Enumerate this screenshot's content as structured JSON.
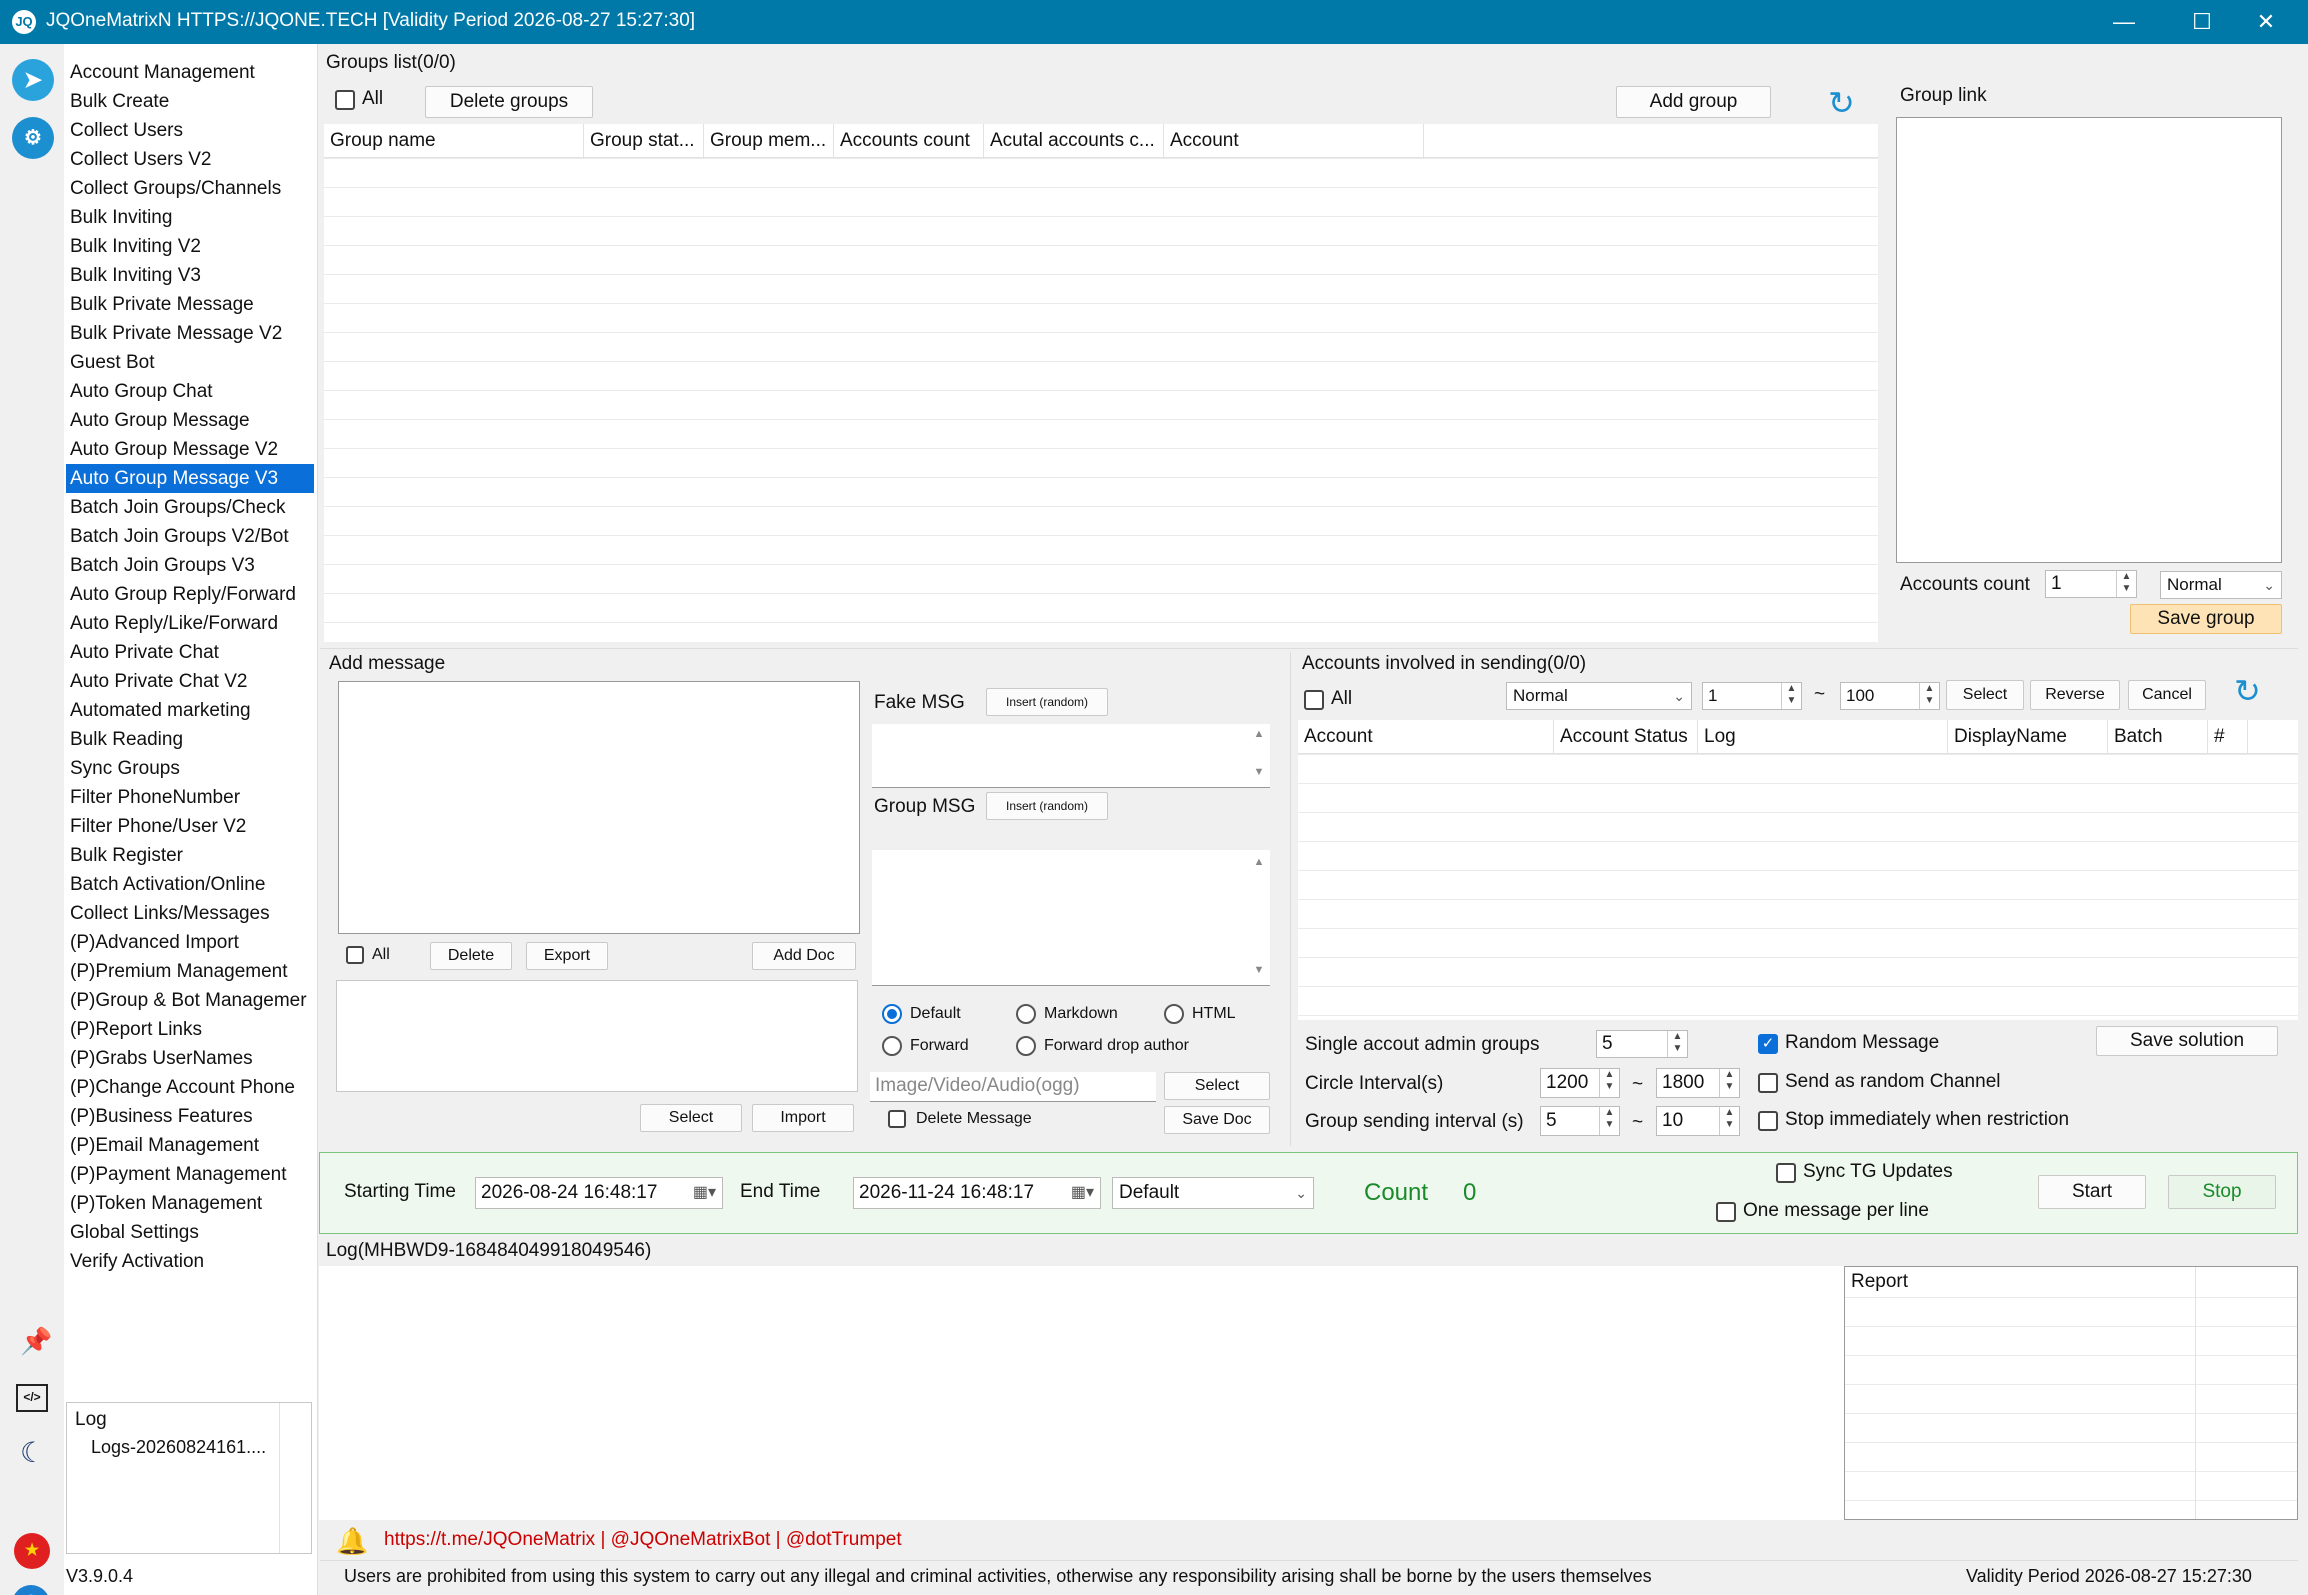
{
  "window": {
    "title": "JQOneMatrixN HTTPS://JQONE.TECH  [Validity Period 2026-08-27 15:27:30]",
    "app_icon_text": "JQ",
    "minimize": "—",
    "maximize": "☐",
    "close": "✕"
  },
  "sidebar_icons": [
    "telegram-icon",
    "tools-icon",
    "pin-icon",
    "code-icon",
    "moon-icon",
    "china-flag-icon",
    "help-icon"
  ],
  "menu": {
    "items": [
      "Account Management",
      "Bulk Create",
      "Collect Users",
      "Collect Users V2",
      "Collect Groups/Channels",
      "Bulk Inviting",
      "Bulk Inviting V2",
      "Bulk Inviting V3",
      "Bulk Private Message",
      "Bulk Private Message V2",
      "Guest Bot",
      "Auto Group Chat",
      "Auto Group Message",
      "Auto Group Message V2",
      "Auto Group Message V3",
      "Batch Join Groups/Check",
      "Batch Join Groups V2/Bot",
      "Batch Join Groups V3",
      "Auto Group Reply/Forward",
      "Auto Reply/Like/Forward",
      "Auto Private Chat",
      "Auto Private Chat V2",
      "Automated marketing",
      "Bulk Reading",
      "Sync Groups",
      "Filter PhoneNumber",
      "Filter Phone/User V2",
      "Bulk Register",
      "Batch Activation/Online",
      "Collect Links/Messages",
      "(P)Advanced Import",
      "(P)Premium Management",
      "(P)Group & Bot Managemer",
      "(P)Report Links",
      "(P)Grabs UserNames",
      "(P)Change Account Phone",
      "(P)Business Features",
      "(P)Email Management",
      "(P)Payment Management",
      "(P)Token Management",
      "Global Settings",
      "Verify Activation"
    ],
    "active_index": 14
  },
  "log_list": {
    "header": "Log",
    "item": "Logs-20260824161...."
  },
  "version": "V3.9.0.4",
  "groups": {
    "title": "Groups list(0/0)",
    "all_label": "All",
    "delete_button": "Delete groups",
    "add_button": "Add group",
    "columns": [
      "Group name",
      "Group stat...",
      "Group mem...",
      "Accounts count",
      "Acutal accounts c...",
      "Account"
    ]
  },
  "group_link": {
    "title": "Group link",
    "accounts_count_label": "Accounts count",
    "accounts_count_value": "1",
    "mode_value": "Normal",
    "save_button": "Save group"
  },
  "add_message": {
    "title": "Add message",
    "all_label": "All",
    "delete_button": "Delete",
    "export_button": "Export",
    "add_doc_button": "Add Doc",
    "select_button": "Select",
    "import_button": "Import"
  },
  "fake_msg": {
    "label": "Fake MSG",
    "insert_button": "Insert (random)"
  },
  "group_msg": {
    "label": "Group MSG",
    "insert_button": "Insert (random)"
  },
  "format": {
    "default": "Default",
    "markdown": "Markdown",
    "html": "HTML",
    "forward": "Forward",
    "forward_drop": "Forward drop author",
    "selected": "Default"
  },
  "media": {
    "placeholder": "Image/Video/Audio(ogg)",
    "select_button": "Select",
    "delete_message": "Delete Message",
    "save_doc_button": "Save Doc"
  },
  "accounts": {
    "title": "Accounts involved in sending(0/0)",
    "all_label": "All",
    "mode_value": "Normal",
    "from_value": "1",
    "tilde": "~",
    "to_value": "100",
    "select_button": "Select",
    "reverse_button": "Reverse",
    "cancel_button": "Cancel",
    "columns": [
      "Account",
      "Account Status",
      "Log",
      "DisplayName",
      "Batch",
      "#"
    ]
  },
  "settings": {
    "admin_groups_label": "Single accout admin groups",
    "admin_groups_value": "5",
    "circle_label": "Circle Interval(s)",
    "circle_min": "1200",
    "circle_max": "1800",
    "group_interval_label": "Group sending interval (s)",
    "group_min": "5",
    "group_max": "10",
    "tilde": "~",
    "random_message": "Random Message",
    "random_channel": "Send as random Channel",
    "stop_restriction": "Stop immediately when restriction",
    "save_solution_button": "Save solution"
  },
  "schedule": {
    "start_label": "Starting Time",
    "start_value": "2026-08-24 16:48:17",
    "end_label": "End Time",
    "end_value": "2026-11-24 16:48:17",
    "mode_value": "Default",
    "count_label": "Count",
    "count_value": "0",
    "sync_tg": "Sync TG Updates",
    "one_per_line": "One message per line",
    "start_button": "Start",
    "stop_button": "Stop"
  },
  "log": {
    "title": "Log(MHBWD9-168484049918049546)",
    "report_header": "Report"
  },
  "footer": {
    "links": "https://t.me/JQOneMatrix | @JQOneMatrixBot | @dotTrumpet",
    "notice": "Users are prohibited from using this system to carry out any illegal and criminal activities, otherwise any responsibility arising shall be borne by the users themselves",
    "validity": "Validity Period 2026-08-27 15:27:30"
  },
  "colors": {
    "titlebar": "#0078a8",
    "accent": "#0a6fd8",
    "count": "#1a8a2a",
    "link": "#cc0000",
    "save_group": "#fde3b5"
  }
}
